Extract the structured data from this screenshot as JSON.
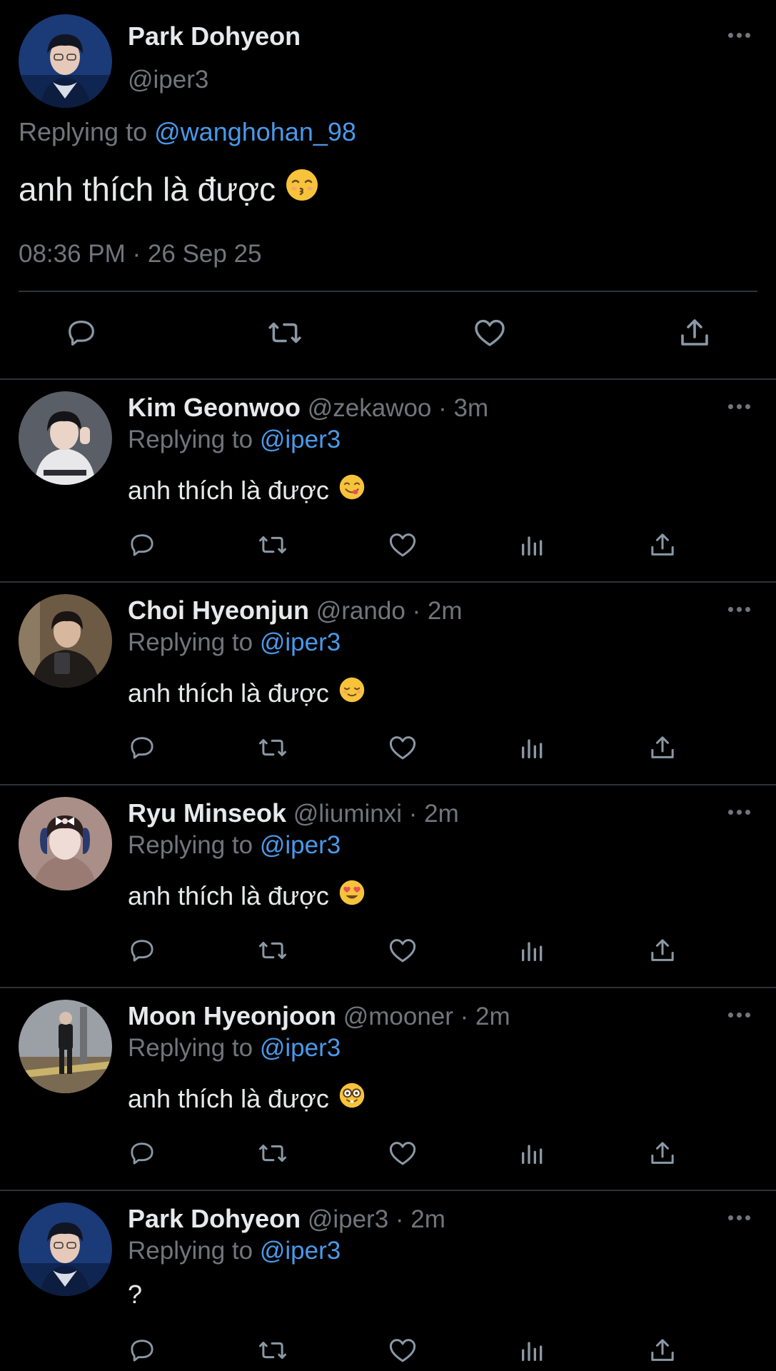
{
  "main_tweet": {
    "name": "Park Dohyeon",
    "handle": "@iper3",
    "replying_prefix": "Replying to",
    "replying_to": "@wanghohan_98",
    "text": "anh thích là được",
    "emoji_icon": "kissing-closed-eyes-emoji",
    "timestamp": "08:36 PM · 26 Sep 25",
    "actions": [
      "reply-icon",
      "retweet-icon",
      "like-icon",
      "share-icon"
    ]
  },
  "replies": [
    {
      "name": "Kim Geonwoo",
      "handle": "@zekawoo",
      "dot": "·",
      "time": "3m",
      "replying_prefix": "Replying to",
      "replying_to": "@iper3",
      "text": "anh thích là được",
      "emoji_icon": "yum-face-emoji"
    },
    {
      "name": "Choi Hyeonjun",
      "handle": "@rando",
      "dot": "·",
      "time": "2m",
      "replying_prefix": "Replying to",
      "replying_to": "@iper3",
      "text": "anh thích là được",
      "emoji_icon": "relieved-face-emoji"
    },
    {
      "name": "Ryu Minseok",
      "handle": "@liuminxi",
      "dot": "·",
      "time": "2m",
      "replying_prefix": "Replying to",
      "replying_to": "@iper3",
      "text": "anh thích là được",
      "emoji_icon": "heart-eyes-emoji"
    },
    {
      "name": "Moon Hyeonjoon",
      "handle": "@mooner",
      "dot": "·",
      "time": "2m",
      "replying_prefix": "Replying to",
      "replying_to": "@iper3",
      "text": "anh thích là được",
      "emoji_icon": "nerd-face-emoji"
    },
    {
      "name": "Park Dohyeon",
      "handle": "@iper3",
      "dot": "·",
      "time": "2m",
      "replying_prefix": "Replying to",
      "replying_to": "@iper3",
      "text": "?",
      "emoji_icon": ""
    }
  ],
  "reply_actions": [
    "reply-icon",
    "retweet-icon",
    "like-icon",
    "views-icon",
    "share-icon"
  ],
  "colors": {
    "background": "#000000",
    "text_primary": "#e7e9ea",
    "text_secondary": "#71767b",
    "mention": "#4a99e9",
    "divider": "#2f3336",
    "emoji_yellow": "#f7c33b"
  }
}
